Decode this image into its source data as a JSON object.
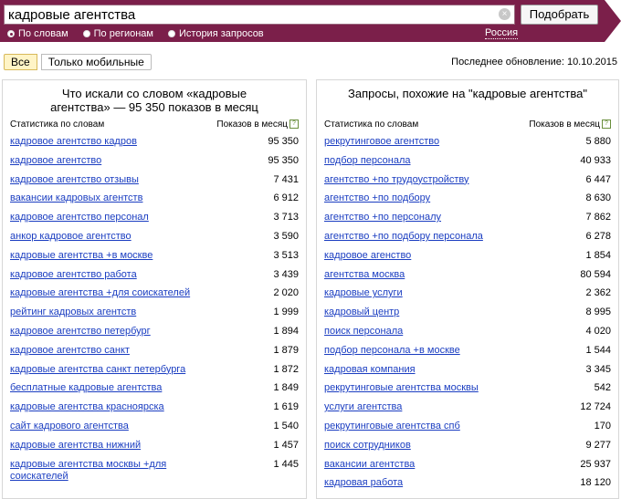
{
  "search": {
    "value": "кадровые агентства",
    "clear_icon": "×",
    "submit_label": "Подобрать"
  },
  "modes": [
    {
      "label": "По словам",
      "selected": true
    },
    {
      "label": "По регионам",
      "selected": false
    },
    {
      "label": "История запросов",
      "selected": false
    }
  ],
  "region": "Россия",
  "filters": {
    "all": "Все",
    "mobile": "Только мобильные"
  },
  "updated": "Последнее обновление: 10.10.2015",
  "left": {
    "title": "Что искали со словом «кадровые агентства» — 95 350 показов в месяц",
    "head_left": "Статистика по словам",
    "head_right": "Показов в месяц",
    "rows": [
      {
        "kw": "кадровое агентство кадров",
        "n": "95 350"
      },
      {
        "kw": "кадровое агентство",
        "n": "95 350"
      },
      {
        "kw": "кадровое агентство отзывы",
        "n": "7 431"
      },
      {
        "kw": "вакансии кадровых агентств",
        "n": "6 912"
      },
      {
        "kw": "кадровое агентство персонал",
        "n": "3 713"
      },
      {
        "kw": "анкор кадровое агентство",
        "n": "3 590"
      },
      {
        "kw": "кадровые агентства +в москве",
        "n": "3 513"
      },
      {
        "kw": "кадровое агентство работа",
        "n": "3 439"
      },
      {
        "kw": "кадровые агентства +для соискателей",
        "n": "2 020"
      },
      {
        "kw": "рейтинг кадровых агентств",
        "n": "1 999"
      },
      {
        "kw": "кадровое агентство петербург",
        "n": "1 894"
      },
      {
        "kw": "кадровое агентство санкт",
        "n": "1 879"
      },
      {
        "kw": "кадровые агентства санкт петербурга",
        "n": "1 872"
      },
      {
        "kw": "бесплатные кадровые агентства",
        "n": "1 849"
      },
      {
        "kw": "кадровые агентства красноярска",
        "n": "1 619"
      },
      {
        "kw": "сайт кадрового агентства",
        "n": "1 540"
      },
      {
        "kw": "кадровые агентства нижний",
        "n": "1 457"
      },
      {
        "kw": "кадровые агентства москвы +для соискателей",
        "n": "1 445"
      }
    ]
  },
  "right": {
    "title": "Запросы, похожие на \"кадровые агентства\"",
    "head_left": "Статистика по словам",
    "head_right": "Показов в месяц",
    "rows": [
      {
        "kw": "рекрутинговое агентство",
        "n": "5 880"
      },
      {
        "kw": "подбор персонала",
        "n": "40 933"
      },
      {
        "kw": "агентство +по трудоустройству",
        "n": "6 447"
      },
      {
        "kw": "агентство +по подбору",
        "n": "8 630"
      },
      {
        "kw": "агентство +по персоналу",
        "n": "7 862"
      },
      {
        "kw": "агентство +по подбору персонала",
        "n": "6 278"
      },
      {
        "kw": "кадровое агенство",
        "n": "1 854"
      },
      {
        "kw": "агентства москва",
        "n": "80 594"
      },
      {
        "kw": "кадровые услуги",
        "n": "2 362"
      },
      {
        "kw": "кадровый центр",
        "n": "8 995"
      },
      {
        "kw": "поиск персонала",
        "n": "4 020"
      },
      {
        "kw": "подбор персонала +в москве",
        "n": "1 544"
      },
      {
        "kw": "кадровая компания",
        "n": "3 345"
      },
      {
        "kw": "рекрутинговые агентства москвы",
        "n": "542"
      },
      {
        "kw": "услуги агентства",
        "n": "12 724"
      },
      {
        "kw": "рекрутинговые агентства спб",
        "n": "170"
      },
      {
        "kw": "поиск сотрудников",
        "n": "9 277"
      },
      {
        "kw": "вакансии агентства",
        "n": "25 937"
      },
      {
        "kw": "кадровая работа",
        "n": "18 120"
      }
    ]
  }
}
